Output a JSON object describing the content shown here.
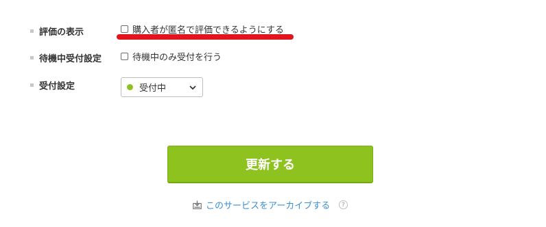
{
  "settings": {
    "rating_display": {
      "label": "評価の表示",
      "option_label": "購入者が匿名で評価できるようにする",
      "checked": false
    },
    "waiting_reception": {
      "label": "待機中受付設定",
      "option_label": "待機中のみ受付を行う",
      "checked": false
    },
    "reception": {
      "label": "受付設定",
      "selected_value": "受付中",
      "status_color": "#8dc21f"
    }
  },
  "actions": {
    "update_label": "更新する",
    "archive_label": "このサービスをアーカイブする",
    "help_label": "?"
  },
  "colors": {
    "accent": "#8dc21f",
    "link": "#3a8fd6",
    "highlight": "#e0151e"
  }
}
